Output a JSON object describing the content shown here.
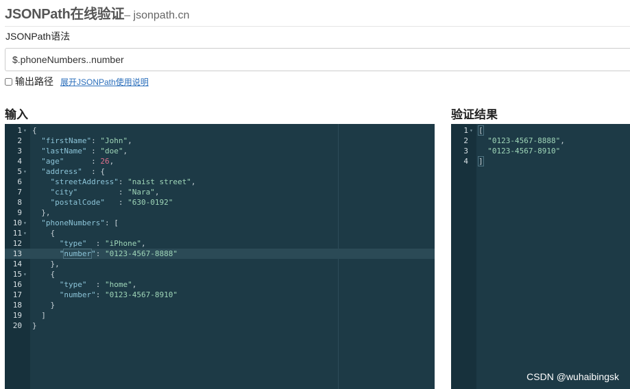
{
  "header": {
    "title": "JSONPath在线验证",
    "subtitle": "– jsonpath.cn"
  },
  "syntax_label": "JSONPath语法",
  "path_input": {
    "value": "$.phoneNumbers..number"
  },
  "output_path": {
    "checked": false,
    "label": "输出路径",
    "help_link": "展开JSONPath使用说明"
  },
  "input_panel": {
    "title": "输入",
    "lines": [
      {
        "n": "1",
        "fold": true,
        "tokens": [
          {
            "t": "{",
            "c": "punc"
          }
        ]
      },
      {
        "n": "2",
        "tokens": [
          {
            "t": "  ",
            "c": "punc"
          },
          {
            "t": "\"firstName\"",
            "c": "key"
          },
          {
            "t": ": ",
            "c": "punc"
          },
          {
            "t": "\"John\"",
            "c": "str"
          },
          {
            "t": ",",
            "c": "punc"
          }
        ]
      },
      {
        "n": "3",
        "tokens": [
          {
            "t": "  ",
            "c": "punc"
          },
          {
            "t": "\"lastName\"",
            "c": "key"
          },
          {
            "t": " : ",
            "c": "punc"
          },
          {
            "t": "\"doe\"",
            "c": "str"
          },
          {
            "t": ",",
            "c": "punc"
          }
        ]
      },
      {
        "n": "4",
        "tokens": [
          {
            "t": "  ",
            "c": "punc"
          },
          {
            "t": "\"age\"",
            "c": "key"
          },
          {
            "t": "      : ",
            "c": "punc"
          },
          {
            "t": "26",
            "c": "num"
          },
          {
            "t": ",",
            "c": "punc"
          }
        ]
      },
      {
        "n": "5",
        "fold": true,
        "tokens": [
          {
            "t": "  ",
            "c": "punc"
          },
          {
            "t": "\"address\"",
            "c": "key"
          },
          {
            "t": "  : {",
            "c": "punc"
          }
        ]
      },
      {
        "n": "6",
        "tokens": [
          {
            "t": "    ",
            "c": "punc"
          },
          {
            "t": "\"streetAddress\"",
            "c": "key"
          },
          {
            "t": ": ",
            "c": "punc"
          },
          {
            "t": "\"naist street\"",
            "c": "str"
          },
          {
            "t": ",",
            "c": "punc"
          }
        ]
      },
      {
        "n": "7",
        "tokens": [
          {
            "t": "    ",
            "c": "punc"
          },
          {
            "t": "\"city\"",
            "c": "key"
          },
          {
            "t": "         : ",
            "c": "punc"
          },
          {
            "t": "\"Nara\"",
            "c": "str"
          },
          {
            "t": ",",
            "c": "punc"
          }
        ]
      },
      {
        "n": "8",
        "tokens": [
          {
            "t": "    ",
            "c": "punc"
          },
          {
            "t": "\"postalCode\"",
            "c": "key"
          },
          {
            "t": "   : ",
            "c": "punc"
          },
          {
            "t": "\"630-0192\"",
            "c": "str"
          }
        ]
      },
      {
        "n": "9",
        "tokens": [
          {
            "t": "  },",
            "c": "punc"
          }
        ]
      },
      {
        "n": "10",
        "fold": true,
        "tokens": [
          {
            "t": "  ",
            "c": "punc"
          },
          {
            "t": "\"phoneNumbers\"",
            "c": "key"
          },
          {
            "t": ": [",
            "c": "punc"
          }
        ]
      },
      {
        "n": "11",
        "fold": true,
        "tokens": [
          {
            "t": "    {",
            "c": "punc"
          }
        ]
      },
      {
        "n": "12",
        "tokens": [
          {
            "t": "      ",
            "c": "punc"
          },
          {
            "t": "\"type\"",
            "c": "key"
          },
          {
            "t": "  : ",
            "c": "punc"
          },
          {
            "t": "\"iPhone\"",
            "c": "str"
          },
          {
            "t": ",",
            "c": "punc"
          }
        ]
      },
      {
        "n": "13",
        "active": true,
        "tokens": [
          {
            "t": "      ",
            "c": "punc"
          },
          {
            "t": "\"",
            "c": "key"
          },
          {
            "t": "number",
            "c": "key hl"
          },
          {
            "t": "\"",
            "c": "key"
          },
          {
            "t": ": ",
            "c": "punc"
          },
          {
            "t": "\"0123-4567-8888\"",
            "c": "str"
          }
        ]
      },
      {
        "n": "14",
        "tokens": [
          {
            "t": "    },",
            "c": "punc"
          }
        ]
      },
      {
        "n": "15",
        "fold": true,
        "tokens": [
          {
            "t": "    {",
            "c": "punc"
          }
        ]
      },
      {
        "n": "16",
        "tokens": [
          {
            "t": "      ",
            "c": "punc"
          },
          {
            "t": "\"type\"",
            "c": "key"
          },
          {
            "t": "  : ",
            "c": "punc"
          },
          {
            "t": "\"home\"",
            "c": "str"
          },
          {
            "t": ",",
            "c": "punc"
          }
        ]
      },
      {
        "n": "17",
        "tokens": [
          {
            "t": "      ",
            "c": "punc"
          },
          {
            "t": "\"number\"",
            "c": "key"
          },
          {
            "t": ": ",
            "c": "punc"
          },
          {
            "t": "\"0123-4567-8910\"",
            "c": "str"
          }
        ]
      },
      {
        "n": "18",
        "tokens": [
          {
            "t": "    }",
            "c": "punc"
          }
        ]
      },
      {
        "n": "19",
        "tokens": [
          {
            "t": "  ]",
            "c": "punc"
          }
        ]
      },
      {
        "n": "20",
        "tokens": [
          {
            "t": "}",
            "c": "punc"
          }
        ]
      }
    ]
  },
  "result_panel": {
    "title": "验证结果",
    "lines": [
      {
        "n": "1",
        "fold": true,
        "tokens": [
          {
            "t": "[",
            "c": "punc hl"
          }
        ]
      },
      {
        "n": "2",
        "tokens": [
          {
            "t": "  ",
            "c": "punc"
          },
          {
            "t": "\"0123-4567-8888\"",
            "c": "str"
          },
          {
            "t": ",",
            "c": "punc"
          }
        ]
      },
      {
        "n": "3",
        "tokens": [
          {
            "t": "  ",
            "c": "punc"
          },
          {
            "t": "\"0123-4567-8910\"",
            "c": "str"
          }
        ]
      },
      {
        "n": "4",
        "tokens": [
          {
            "t": "]",
            "c": "punc hl"
          }
        ]
      }
    ]
  },
  "watermark": "CSDN @wuhaibingsk",
  "colors": {
    "editor_bg": "#1d3a46",
    "gutter_bg": "#17313c",
    "key": "#8cc4d8",
    "string": "#9fd6b8",
    "number": "#e0708c",
    "link": "#2a6ebb"
  }
}
